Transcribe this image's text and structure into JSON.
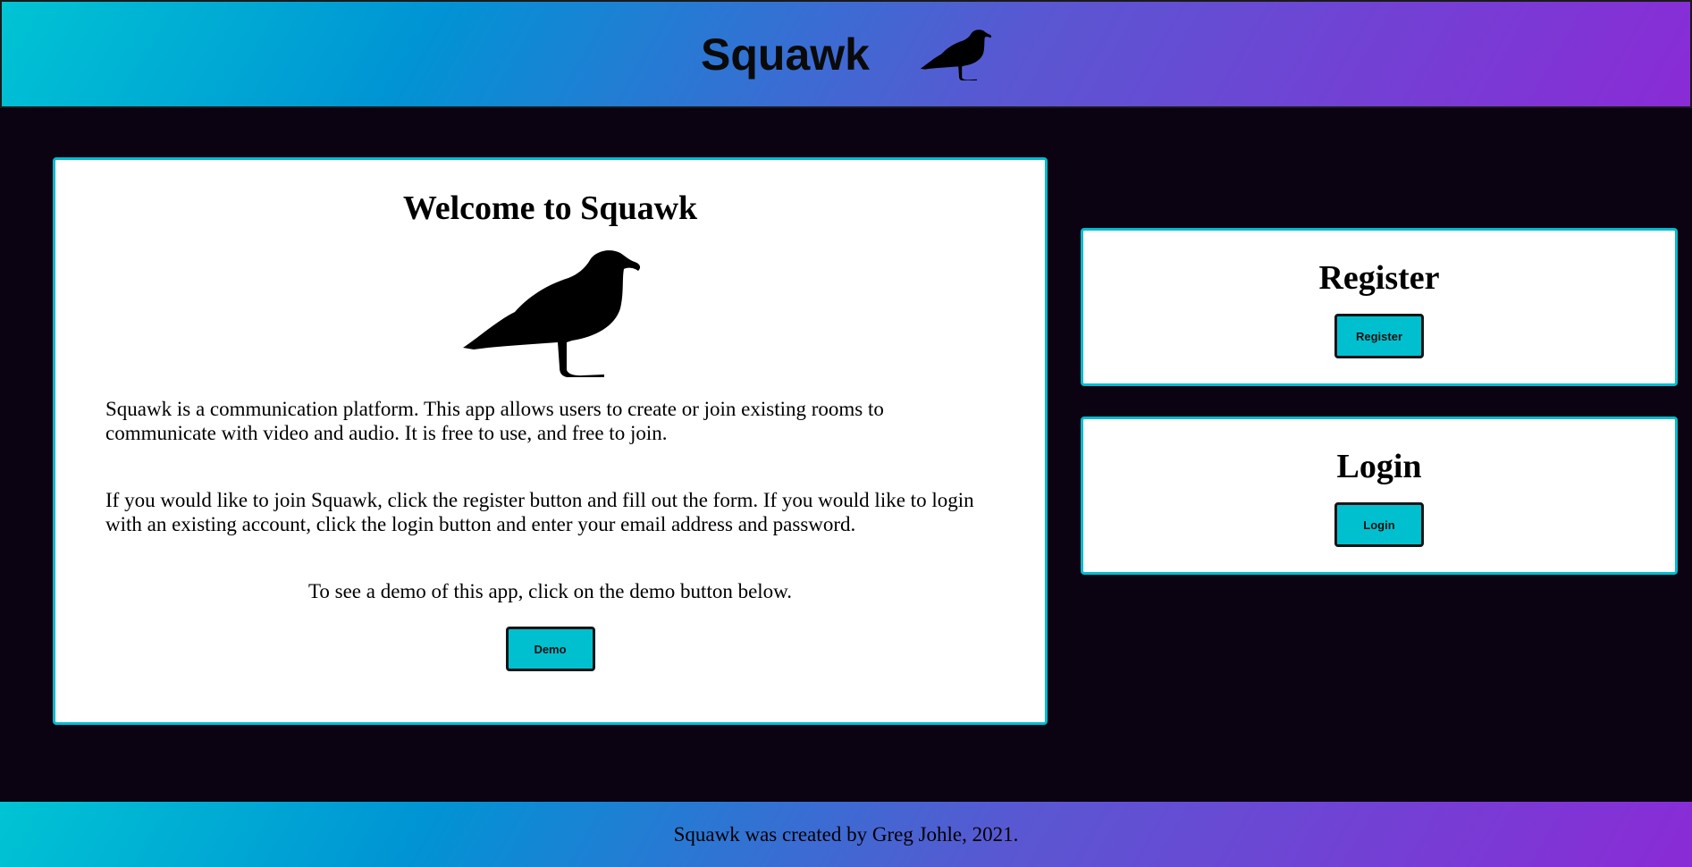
{
  "header": {
    "title": "Squawk",
    "logo_icon": "seagull-icon"
  },
  "welcome": {
    "heading": "Welcome to Squawk",
    "image_icon": "seagull-icon",
    "paragraph_1": "Squawk is a communication platform. This app allows users to create or join existing rooms to communicate with video and audio. It is free to use, and free to join.",
    "paragraph_2": "If you would like to join Squawk, click the register button and fill out the form. If you would like to login with an existing account, click the login button and enter your email address and password.",
    "paragraph_3": "To see a demo of this app, click on the demo button below.",
    "demo_label": "Demo"
  },
  "register": {
    "heading": "Register",
    "button_label": "Register"
  },
  "login": {
    "heading": "Login",
    "button_label": "Login"
  },
  "footer": {
    "text": "Squawk was created by Greg Johle, 2021."
  },
  "colors": {
    "background": "#0b0212",
    "accent": "#00c0d0",
    "gradient_start": "#00c4d4",
    "gradient_end": "#8a2bd6"
  }
}
